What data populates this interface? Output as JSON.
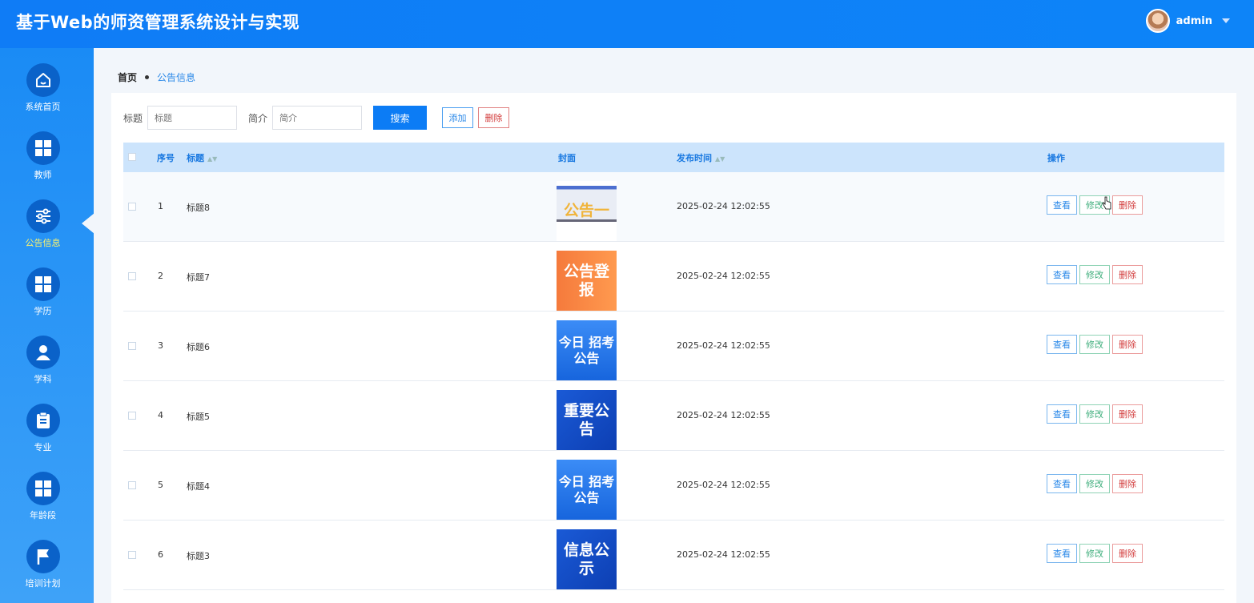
{
  "app": {
    "title": "基于Web的师资管理系统设计与实现",
    "user": "admin"
  },
  "sidebar": {
    "items": [
      {
        "label": "系统首页",
        "icon": "home-icon"
      },
      {
        "label": "教师",
        "icon": "grid-icon"
      },
      {
        "label": "公告信息",
        "icon": "sliders-icon",
        "active": true
      },
      {
        "label": "学历",
        "icon": "grid-icon"
      },
      {
        "label": "学科",
        "icon": "person-icon"
      },
      {
        "label": "专业",
        "icon": "clipboard-icon"
      },
      {
        "label": "年龄段",
        "icon": "grid-icon"
      },
      {
        "label": "培训计划",
        "icon": "flag-icon"
      }
    ]
  },
  "breadcrumb": {
    "home": "首页",
    "current": "公告信息"
  },
  "search": {
    "title_label": "标题",
    "title_placeholder": "标题",
    "intro_label": "简介",
    "intro_placeholder": "简介",
    "search_btn": "搜索",
    "add_btn": "添加",
    "delete_btn": "删除"
  },
  "table": {
    "headers": {
      "index": "序号",
      "title": "标题",
      "cover": "封面",
      "time": "发布时间",
      "ops": "操作"
    },
    "actions": {
      "view": "查看",
      "edit": "修改",
      "delete": "删除"
    },
    "rows": [
      {
        "index": "1",
        "title": "标题8",
        "cover_text": "公告一",
        "time": "2025-02-24 12:02:55",
        "cover_style": "light"
      },
      {
        "index": "2",
        "title": "标题7",
        "cover_text": "公告登报",
        "time": "2025-02-24 12:02:55",
        "cover_style": "orange"
      },
      {
        "index": "3",
        "title": "标题6",
        "cover_text": "今日 招考公告",
        "time": "2025-02-24 12:02:55",
        "cover_style": "blue"
      },
      {
        "index": "4",
        "title": "标题5",
        "cover_text": "重要公告",
        "time": "2025-02-24 12:02:55",
        "cover_style": "darkblue"
      },
      {
        "index": "5",
        "title": "标题4",
        "cover_text": "今日 招考公告",
        "time": "2025-02-24 12:02:55",
        "cover_style": "blue"
      },
      {
        "index": "6",
        "title": "标题3",
        "cover_text": "信息公示",
        "time": "2025-02-24 12:02:55",
        "cover_style": "darkblue"
      }
    ]
  },
  "colors": {
    "primary": "#0c7cf5",
    "sidebar": "#1a8bf5",
    "active_label": "#fff46b"
  }
}
